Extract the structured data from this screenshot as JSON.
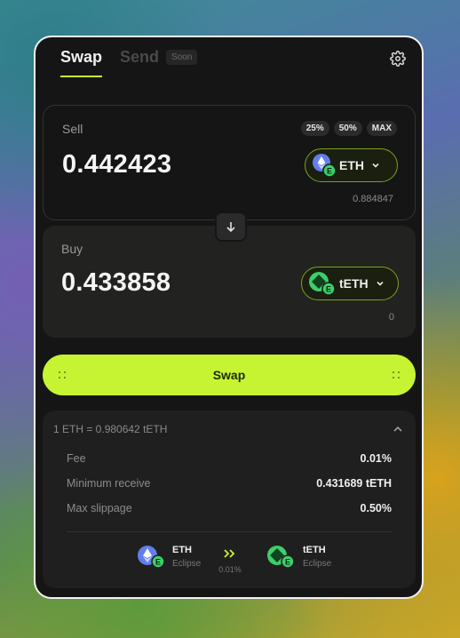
{
  "tabs": [
    {
      "label": "Swap",
      "active": true
    },
    {
      "label": "Send",
      "active": false
    }
  ],
  "soon_badge": "Soon",
  "icons": {
    "settings": "gear-icon",
    "switch": "arrow-down-icon",
    "expand": "chevron-up-icon"
  },
  "colors": {
    "accent": "#c6f432",
    "eth": "#627eea",
    "teth": "#3ccf6b",
    "eclipse": "#3ccf6b"
  },
  "sell": {
    "label": "Sell",
    "amount": "0.442423",
    "token": "ETH",
    "balance": "0.884847",
    "percent_buttons": [
      "25%",
      "50%",
      "MAX"
    ]
  },
  "buy": {
    "label": "Buy",
    "amount": "0.433858",
    "token": "tETH",
    "balance": "0"
  },
  "swap_button": "Swap",
  "details": {
    "rate": "1 ETH = 0.980642 tETH",
    "rows": [
      {
        "label": "Fee",
        "value": "0.01%"
      },
      {
        "label": "Minimum receive",
        "value": "0.431689 tETH"
      },
      {
        "label": "Max slippage",
        "value": "0.50%"
      }
    ],
    "route": {
      "from": {
        "token": "ETH",
        "chain": "Eclipse"
      },
      "to": {
        "token": "tETH",
        "chain": "Eclipse"
      },
      "fee": "0.01%"
    }
  }
}
